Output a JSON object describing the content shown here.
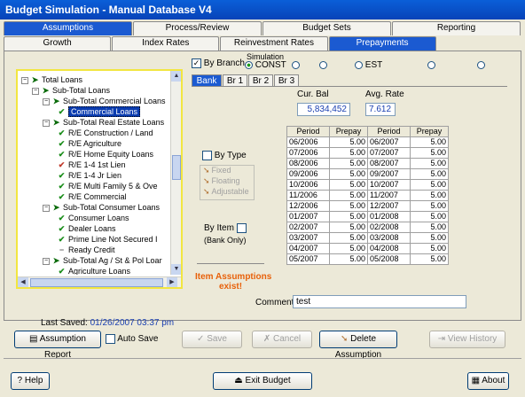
{
  "window": {
    "title": "Budget Simulation - Manual Database V4"
  },
  "tabs_top": [
    "Assumptions",
    "Process/Review",
    "Budget Sets",
    "Reporting"
  ],
  "tabs_second": [
    "Growth",
    "Index Rates",
    "Reinvestment Rates",
    "Prepayments"
  ],
  "tree": {
    "nodes": [
      {
        "label": "Total Loans"
      },
      {
        "label": "Sub-Total Loans"
      },
      {
        "label": "Sub-Total Commercial Loans"
      },
      {
        "label": "Commercial Loans"
      },
      {
        "label": "Sub-Total Real Estate Loans"
      },
      {
        "label": "R/E Construction / Land"
      },
      {
        "label": "R/E Agriculture"
      },
      {
        "label": "R/E Home Equity Loans"
      },
      {
        "label": "R/E 1-4 1st Lien"
      },
      {
        "label": "R/E 1-4 Jr Lien"
      },
      {
        "label": "R/E Multi Family 5 & Ove"
      },
      {
        "label": "R/E Commercial"
      },
      {
        "label": "Sub-Total Consumer Loans"
      },
      {
        "label": "Consumer Loans"
      },
      {
        "label": "Dealer Loans"
      },
      {
        "label": "Prime Line Not Secured I"
      },
      {
        "label": "Ready Credit"
      },
      {
        "label": "Sub-Total Ag / St & Pol Loar"
      },
      {
        "label": "Agriculture Loans"
      }
    ]
  },
  "by_branch": {
    "label": "By Branch",
    "checked": true
  },
  "simulation": {
    "label": "Simulation",
    "selected": "CONST",
    "alt": "EST"
  },
  "branch_tabs": [
    "Bank",
    "Br 1",
    "Br 2",
    "Br 3"
  ],
  "cur_bal": {
    "label": "Cur. Bal",
    "value": "5,834,452"
  },
  "avg_rate": {
    "label": "Avg. Rate",
    "value": "7.612"
  },
  "by_type": {
    "label": "By Type",
    "items": [
      "Fixed",
      "Floating",
      "Adjustable"
    ]
  },
  "by_item": {
    "label": "By Item",
    "note": "(Bank Only)"
  },
  "item_assumptions": {
    "line1": "Item Assumptions",
    "line2": "exist!"
  },
  "grid": {
    "headers": [
      "Period",
      "Prepay",
      "Period",
      "Prepay"
    ],
    "rows": [
      [
        "06/2006",
        "5.00",
        "06/2007",
        "5.00"
      ],
      [
        "07/2006",
        "5.00",
        "07/2007",
        "5.00"
      ],
      [
        "08/2006",
        "5.00",
        "08/2007",
        "5.00"
      ],
      [
        "09/2006",
        "5.00",
        "09/2007",
        "5.00"
      ],
      [
        "10/2006",
        "5.00",
        "10/2007",
        "5.00"
      ],
      [
        "11/2006",
        "5.00",
        "11/2007",
        "5.00"
      ],
      [
        "12/2006",
        "5.00",
        "12/2007",
        "5.00"
      ],
      [
        "01/2007",
        "5.00",
        "01/2008",
        "5.00"
      ],
      [
        "02/2007",
        "5.00",
        "02/2008",
        "5.00"
      ],
      [
        "03/2007",
        "5.00",
        "03/2008",
        "5.00"
      ],
      [
        "04/2007",
        "5.00",
        "04/2008",
        "5.00"
      ],
      [
        "05/2007",
        "5.00",
        "05/2008",
        "5.00"
      ]
    ]
  },
  "comment": {
    "label": "Comment:",
    "value": "test"
  },
  "last_saved": {
    "label": "Last Saved:",
    "value": "01/26/2007 03:37 pm"
  },
  "buttons": {
    "assumption_report": "Assumption Report",
    "auto_save": "Auto Save",
    "save": "Save",
    "cancel": "Cancel",
    "delete_assumption": "Delete Assumption",
    "view_history": "View History",
    "help": "Help",
    "exit_budget": "Exit Budget",
    "about": "About"
  }
}
